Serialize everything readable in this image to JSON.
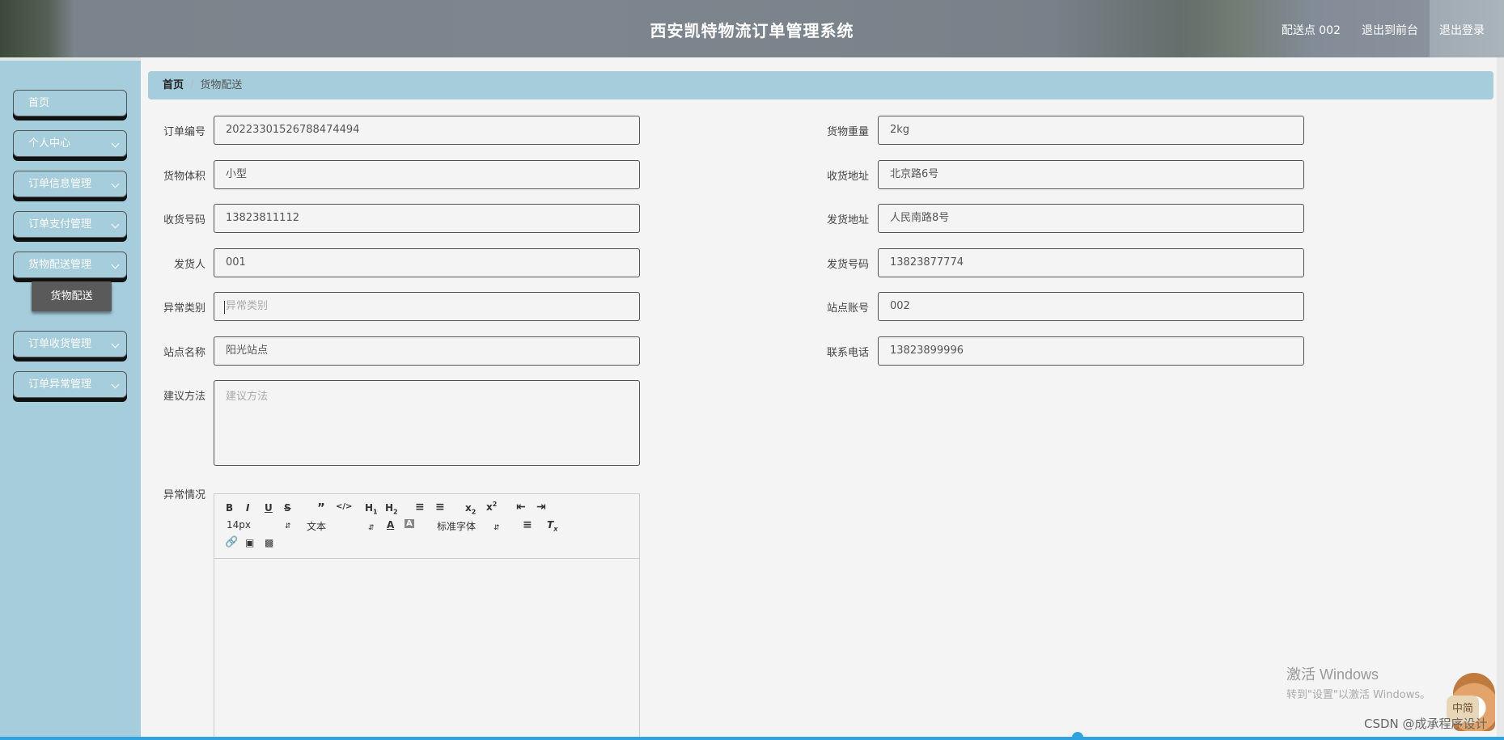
{
  "header": {
    "title": "西安凯特物流订单管理系统",
    "station": "配送点 002",
    "to_front": "退出到前台",
    "logout": "退出登录"
  },
  "sidebar": {
    "items": [
      {
        "label": "首页"
      },
      {
        "label": "个人中心"
      },
      {
        "label": "订单信息管理"
      },
      {
        "label": "订单支付管理"
      },
      {
        "label": "货物配送管理"
      },
      {
        "label": "订单收货管理"
      },
      {
        "label": "订单异常管理"
      }
    ],
    "submenu": "货物配送"
  },
  "breadcrumb": {
    "home": "首页",
    "separator": "/",
    "current": "货物配送"
  },
  "form": {
    "order_no": {
      "label": "订单编号",
      "value": "20223301526788474494"
    },
    "weight": {
      "label": "货物重量",
      "value": "2kg"
    },
    "volume": {
      "label": "货物体积",
      "value": "小型"
    },
    "recv_addr": {
      "label": "收货地址",
      "value": "北京路6号"
    },
    "recv_phone": {
      "label": "收货号码",
      "value": "13823811112"
    },
    "send_addr": {
      "label": "发货地址",
      "value": "人民南路8号"
    },
    "sender": {
      "label": "发货人",
      "value": "001"
    },
    "send_phone": {
      "label": "发货号码",
      "value": "13823877774"
    },
    "exception_type": {
      "label": "异常类别",
      "placeholder": "异常类别"
    },
    "station_account": {
      "label": "站点账号",
      "value": "002"
    },
    "station_name": {
      "label": "站点名称",
      "value": "阳光站点"
    },
    "contact_phone": {
      "label": "联系电话",
      "value": "13823899996"
    },
    "suggestion": {
      "label": "建议方法",
      "placeholder": "建议方法"
    },
    "exception_detail": {
      "label": "异常情况"
    }
  },
  "editor": {
    "font_size": "14px",
    "text_type": "文本",
    "font_family": "标准字体"
  },
  "watermark": {
    "activate": "激活 Windows",
    "activate_hint": "转到\"设置\"以激活 Windows。",
    "csdn": "CSDN @成承程序设计",
    "zh": "中简"
  }
}
